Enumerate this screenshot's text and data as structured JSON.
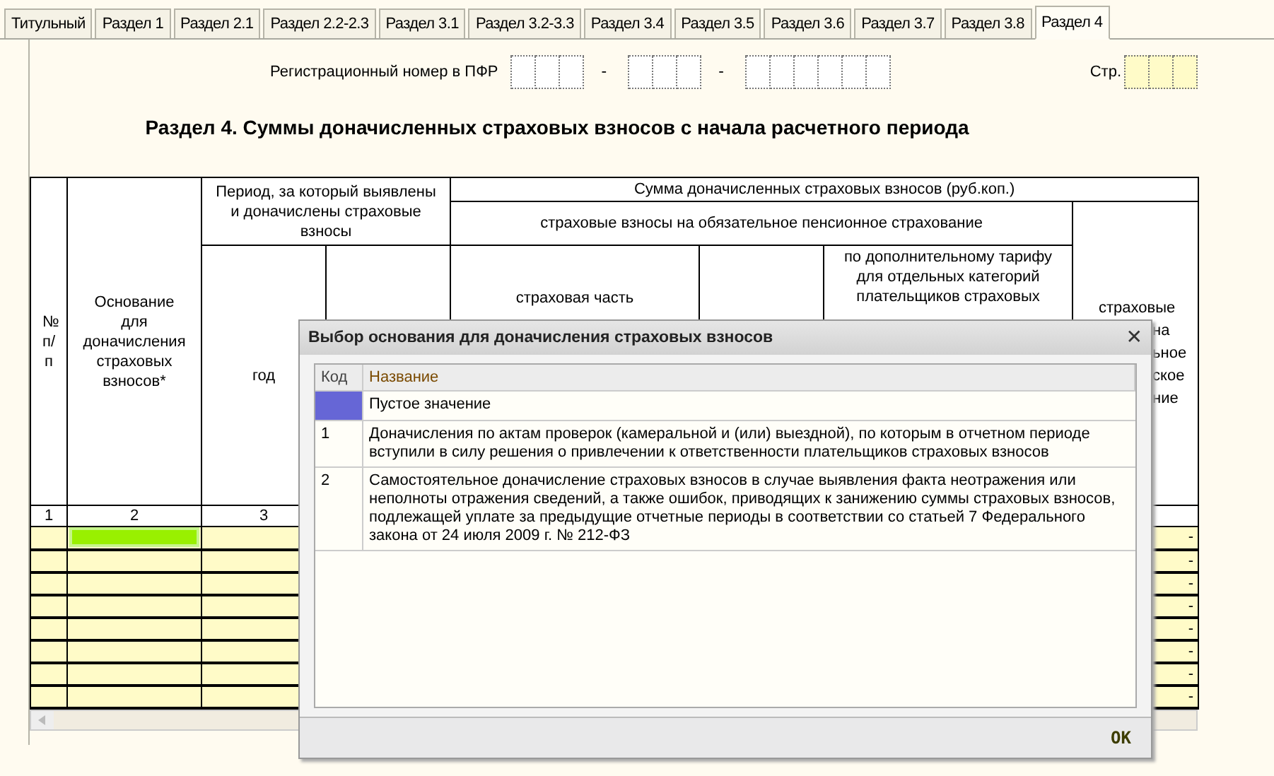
{
  "tabs": [
    {
      "label": "Титульный",
      "selected": false
    },
    {
      "label": "Раздел 1",
      "selected": false
    },
    {
      "label": "Раздел 2.1",
      "selected": false
    },
    {
      "label": "Раздел 2.2-2.3",
      "selected": false
    },
    {
      "label": "Раздел 3.1",
      "selected": false
    },
    {
      "label": "Раздел 3.2-3.3",
      "selected": false
    },
    {
      "label": "Раздел 3.4",
      "selected": false
    },
    {
      "label": "Раздел 3.5",
      "selected": false
    },
    {
      "label": "Раздел 3.6",
      "selected": false
    },
    {
      "label": "Раздел 3.7",
      "selected": false
    },
    {
      "label": "Раздел 3.8",
      "selected": false
    },
    {
      "label": "Раздел 4",
      "selected": true
    }
  ],
  "registration": {
    "label": "Регистрационный номер в ПФР",
    "separators": [
      "-",
      "-"
    ],
    "page_label": "Стр."
  },
  "title": "Раздел 4. Суммы доначисленных страховых взносов с начала расчетного периода",
  "table": {
    "headers": {
      "number": "№ п/п",
      "basis": "Основание для доначисления страховых взносов*",
      "period": "Период, за который выявлены и доначислены страховые взносы",
      "sum": "Сумма доначисленных страховых взносов (руб.коп.)",
      "pension": "страховые взносы на обязательное пенсионное страхование",
      "year": "год",
      "insurance_part": "страховая часть",
      "additional_tariff": "по дополнительному тарифу для отдельных категорий плательщиков страховых",
      "medical_lines": [
        "страховые",
        "на",
        "ьное",
        "ское",
        "ние"
      ]
    },
    "column_numbers": [
      "1",
      "2",
      "3"
    ],
    "rows": [
      {
        "selected": true,
        "last": "-"
      },
      {
        "selected": false,
        "last": "-"
      },
      {
        "selected": false,
        "last": "-"
      },
      {
        "selected": false,
        "last": "-"
      },
      {
        "selected": false,
        "last": "-"
      },
      {
        "selected": false,
        "last": "-"
      },
      {
        "selected": false,
        "last": "-"
      },
      {
        "selected": false,
        "last": "-"
      }
    ]
  },
  "dialog": {
    "title": "Выбор основания для доначисления страховых взносов",
    "close": "✕",
    "columns": [
      "Код",
      "Название"
    ],
    "items": [
      {
        "name": "Пустое значение",
        "selected": true
      },
      {
        "code": "1",
        "name": "Доначисления по актам проверок (камеральной и (или) выездной), по которым в отчетном периоде вступили в силу решения о привлечении к ответственности плательщиков страховых взносов",
        "selected": false
      },
      {
        "code": "2",
        "name": "Самостоятельное доначисление страховых взносов в случае выявления факта неотражения или неполноты отражения сведений, а также ошибок, приводящих к занижению суммы страховых взносов, подлежащей уплате за предыдущие отчетные периоды в соответствии со статьей  7 Федерального закона от 24 июля 2009 г. № 212-ФЗ",
        "selected": false
      }
    ],
    "ok": "OK"
  }
}
